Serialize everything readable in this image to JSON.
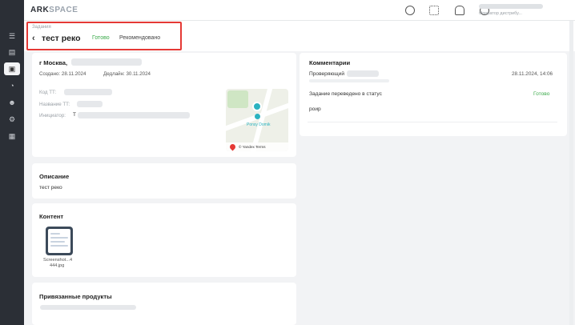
{
  "app": {
    "logo_main": "ARK",
    "logo_accent": "SPACE"
  },
  "user": {
    "role": "Оператор дистрибу..."
  },
  "icons": {
    "rail": [
      "list-icon",
      "database-icon",
      "tasks-icon",
      "chart-icon",
      "users-icon",
      "settings-icon",
      "calendar-icon"
    ],
    "top": [
      "chat-icon",
      "grid-icon",
      "bell-icon",
      "compass-icon"
    ]
  },
  "header": {
    "breadcrumb": "Задания",
    "back_glyph": "‹",
    "title": "тест реко",
    "status_ready": "Готово",
    "status_recommended": "Рекомендовано"
  },
  "info": {
    "city": "г Москва,",
    "created": "Создано: 28.11.2024",
    "deadline": "Дедлайн: 30.11.2024",
    "fields": [
      {
        "label": "Код ТТ:"
      },
      {
        "label": "Название ТТ:"
      },
      {
        "label": "Инициатор:",
        "value": "Т"
      }
    ],
    "map_place": "Ponsy Domik",
    "map_attribution": "© Yandex Terms"
  },
  "description": {
    "heading": "Описание",
    "text": "тест реко"
  },
  "content": {
    "heading": "Контент",
    "file_line1": "Screenshot...4",
    "file_line2": "444.jpg"
  },
  "products": {
    "heading": "Привязанные продукты"
  },
  "comments": {
    "heading": "Комментарии",
    "author_label": "Проверяющий",
    "date": "28.11.2024, 14:06",
    "status_text": "Задание переведено в статус",
    "status_value": "Готово",
    "message": "роир"
  },
  "colors": {
    "ready": "#3aaa4a",
    "highlight": "#e53935",
    "rail": "#2b2f36"
  }
}
